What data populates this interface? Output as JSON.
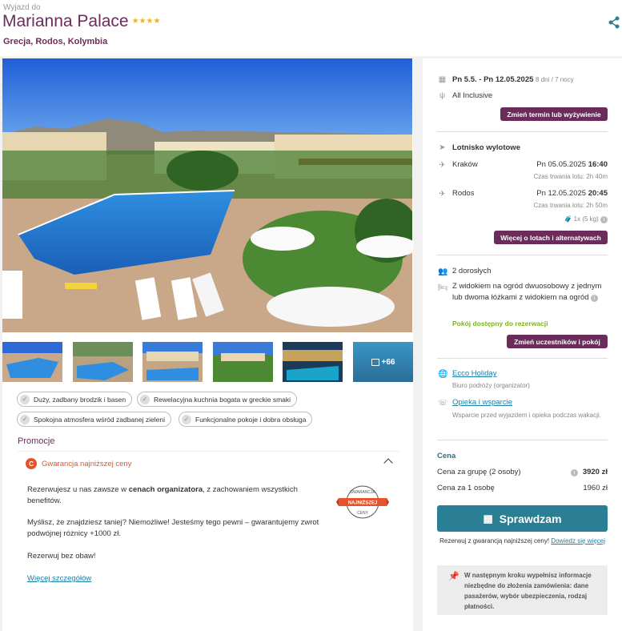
{
  "header": {
    "pre_title": "Wyjazd do",
    "hotel_name": "Marianna Palace",
    "stars": "★★★★",
    "location": "Grecja, Rodos, Kolymbia",
    "share_icon": "share-icon"
  },
  "gallery": {
    "more_label": "+66",
    "more_icon": "gallery-icon"
  },
  "features": [
    "Duży, zadbany brodzik i basen",
    "Rewelacyjna kuchnia bogata w greckie smaki",
    "Spokojna atmosfera wśród zadbanej zieleni",
    "Funkcjonalne pokoje i dobra obsługa"
  ],
  "promo": {
    "section_title": "Promocje",
    "guarantee_label": "Gwarancja najniższej ceny",
    "p1_a": "Rezerwujesz u nas zawsze w ",
    "p1_b": "cenach organizatora",
    "p1_c": ", z zachowaniem wszystkich benefitów.",
    "p2": "Myślisz, że znajdziesz taniej? Niemożliwe! Jesteśmy tego pewni – gwarantujemy zwrot podwójnej różnicy +1000 zł.",
    "p3": "Rezerwuj bez obaw!",
    "more_link": "Więcej szczegółów",
    "badge_top": "GWARANCJA",
    "badge_mid": "NAJNIŻSZEJ",
    "badge_bottom": "CENY"
  },
  "booking": {
    "dates": "Pn 5.5. - Pn 12.05.2025",
    "duration": "8 dni / 7 nocy",
    "board": "All Inclusive",
    "change_term_btn": "Zmień termin lub wyżywienie",
    "airport_label": "Lotnisko wylotowe",
    "out_city": "Kraków",
    "out_date": "Pn 05.05.2025",
    "out_time": "16:40",
    "out_duration": "Czas trwania lotu: 2h 40m",
    "ret_city": "Rodos",
    "ret_date": "Pn 12.05.2025",
    "ret_time": "20:45",
    "ret_duration": "Czas trwania lotu: 2h 50m",
    "luggage": "1x (5 kg)",
    "flights_btn": "Więcej o lotach i alternatywach",
    "guests": "2 dorosłych",
    "room": "Z widokiem na ogród dwuosobowy z jednym lub dwoma łóżkami z widokiem na ogród",
    "room_available": "Pokój dostępny do rezerwacji",
    "change_guests_btn": "Zmień uczestników i pokój",
    "organizer_name": "Ecco Holiday",
    "organizer_desc": "Biuro podróży (organizator)",
    "support_link": "Opieka i wsparcie",
    "support_desc": "Wsparcie przed wyjazdem i opieka podczas wakacji.",
    "price_title": "Cena",
    "price_group_label": "Cena za grupę (2 osoby)",
    "price_group_value": "3920 zł",
    "price_person_label": "Cena za 1 osobę",
    "price_person_value": "1960 zł",
    "check_btn": "Sprawdzam",
    "guarantee_note": "Rezerwuj z gwarancją najniższej ceny!",
    "guarantee_link": "Dowiedz się więcej",
    "next_step_note": "W następnym kroku wypełnisz informacje niezbędne do złożenia zamówienia: dane pasażerów, wybór ubezpieczenia, rodzaj płatności."
  },
  "colors": {
    "brand_purple": "#6b2c5b",
    "cta_teal": "#2a7f95",
    "accent_orange": "#e5532d",
    "available_green": "#7cb518"
  }
}
